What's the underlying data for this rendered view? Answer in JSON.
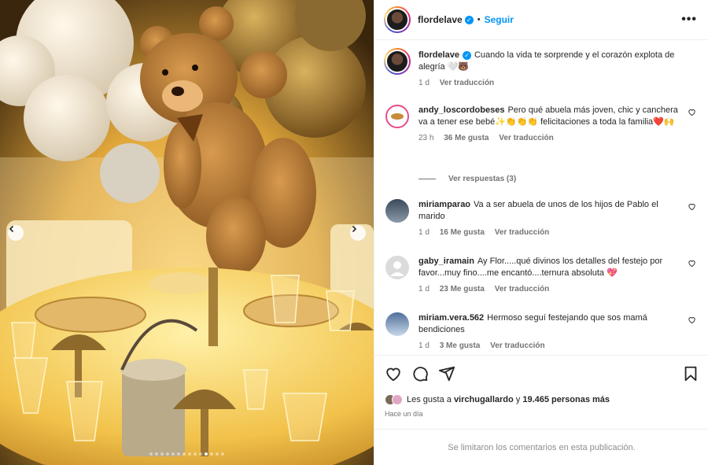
{
  "post": {
    "username": "flordelave",
    "follow_label": "Seguir",
    "dot_separator": "•",
    "more_label": "•••"
  },
  "caption": {
    "username": "flordelave",
    "text": "Cuando la vida te sorprende y el corazón explota de alegría 🤍🐻",
    "time": "1 d",
    "translate": "Ver traducción"
  },
  "comments": [
    {
      "username": "andy_loscordobeses",
      "text": "Pero qué abuela más joven, chic y canchera va a tener ese bebé✨👏👏👏 felicitaciones a toda la familia❤️🙌",
      "time": "23 h",
      "likes": "36 Me gusta",
      "translate": "Ver traducción"
    },
    {
      "username": "miriamparao",
      "text": "Va a ser abuela de unos de los hijos de Pablo el marido",
      "time": "1 d",
      "likes": "16 Me gusta",
      "translate": "Ver traducción"
    },
    {
      "username": "gaby_iramain",
      "text": "Ay Flor.....qué divinos los detalles del festejo por favor...muy fino....me encantó....ternura absoluta 💖",
      "time": "1 d",
      "likes": "23 Me gusta",
      "translate": "Ver traducción"
    },
    {
      "username": "miriam.vera.562",
      "text": "Hermoso seguí festejando que sos mamá bendiciones",
      "time": "1 d",
      "likes": "3 Me gusta",
      "translate": "Ver traducción"
    }
  ],
  "replies_label": "Ver respuestas (3)",
  "likes_line": {
    "prefix": "Les gusta a",
    "user": "virchugallardo",
    "and": "y",
    "others": "19.465 personas más"
  },
  "posted_ago": "Hace un día",
  "footer_text": "Se limitaron los comentarios en esta publicación.",
  "carousel": {
    "total_slides": 14,
    "active_index": 10
  },
  "colors": {
    "accent": "#0095f6",
    "muted": "#737373",
    "heart_red": "#ed4956"
  }
}
